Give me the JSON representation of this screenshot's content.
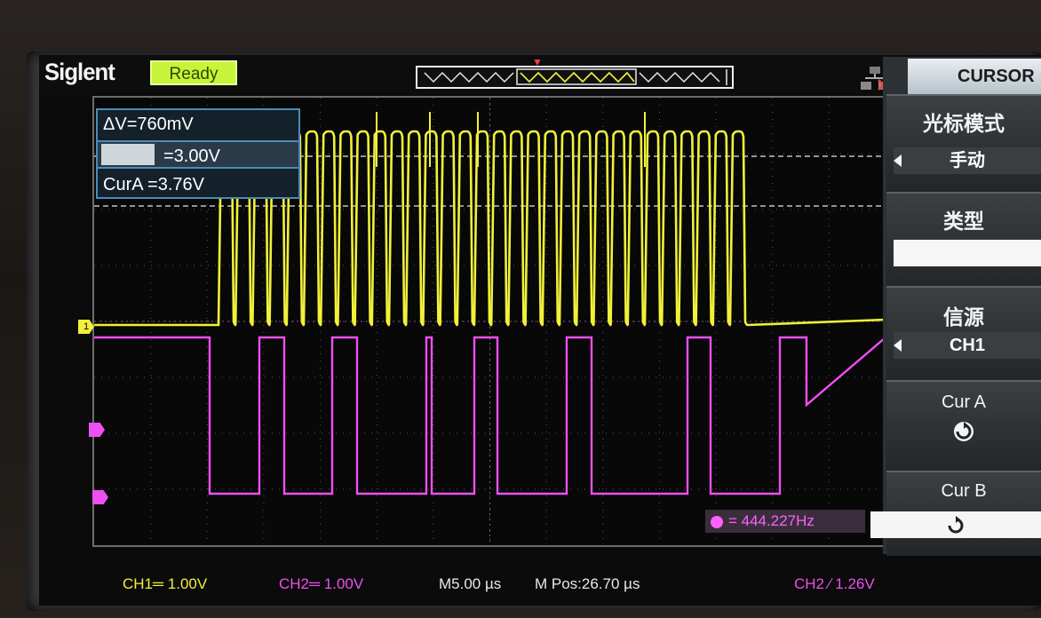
{
  "brand": "Siglent",
  "status": "Ready",
  "colors": {
    "ch1": "#f1f03a",
    "ch2": "#ee4ff0",
    "cursor_box": "#4b8cb8",
    "ready_bg": "#c6f43a"
  },
  "measurements": {
    "delta": "ΔV=760mV",
    "curb": "=3.00V",
    "cura": "CurA =3.76V"
  },
  "markers": {
    "ch1": "1"
  },
  "frequency": "= 444.227Hz",
  "bottom": {
    "ch1": "CH1═ 1.00V",
    "ch2": "CH2═ 1.00V",
    "timebase": "M5.00 µs",
    "mpos": "M Pos:26.70 µs",
    "trigger": "CH2 ∕ 1.26V"
  },
  "menu": {
    "title": "CURSOR",
    "mode_label": "光标模式",
    "mode_value": "手动",
    "type_label": "类型",
    "type_value": "",
    "source_label": "信源",
    "source_value": "CH1",
    "cur_a_label": "Cur A",
    "cur_b_label": "Cur B",
    "cur_a_icon": "rotate-knob-icon",
    "cur_b_icon": "rotate-knob-icon"
  }
}
